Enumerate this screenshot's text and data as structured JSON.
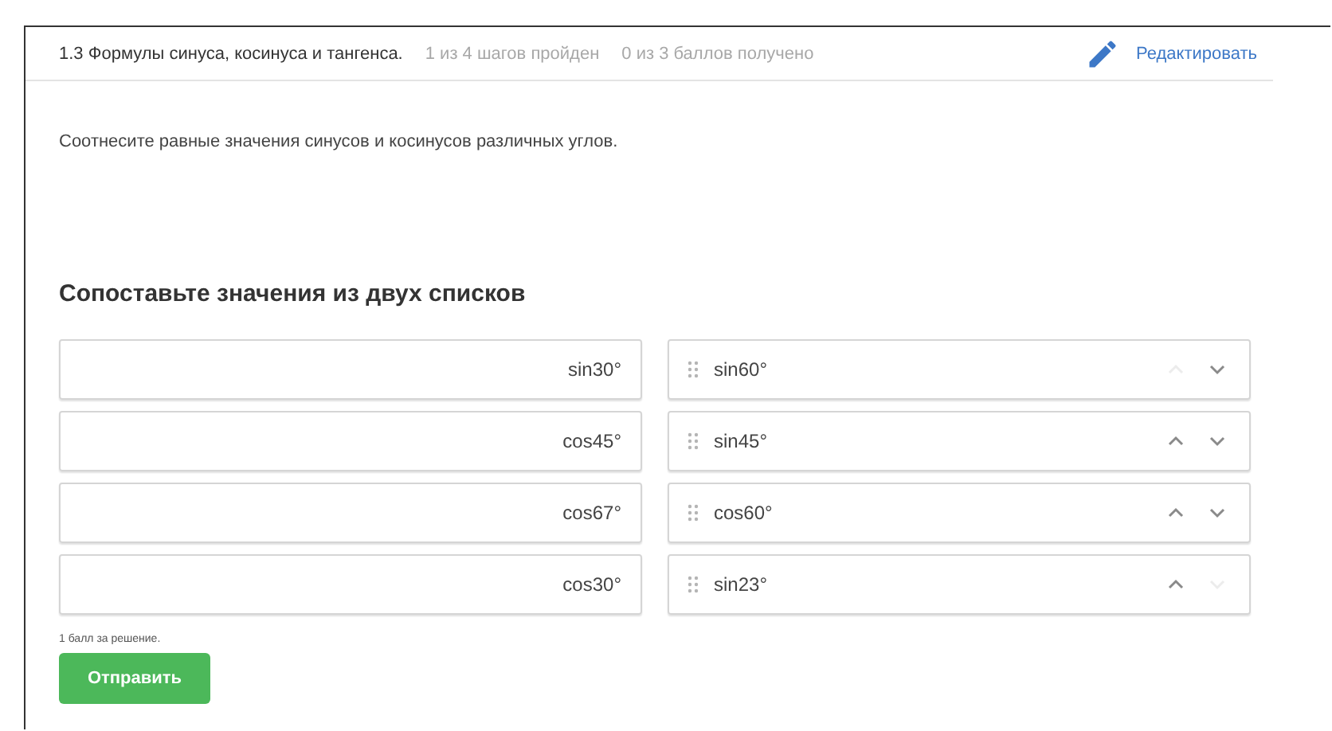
{
  "header": {
    "title": "1.3 Формулы синуса, косинуса и тангенса.",
    "steps": "1 из 4 шагов пройден",
    "points": "0 из 3 баллов  получено",
    "edit_link": "Редактировать"
  },
  "instruction": "Соотнесите равные значения синусов и косинусов различных углов.",
  "task_title": "Сопоставьте значения из двух списков",
  "pairs": [
    {
      "left": "sin30°",
      "right": "sin60°",
      "up_disabled": true,
      "down_disabled": false
    },
    {
      "left": "cos45°",
      "right": "sin45°",
      "up_disabled": false,
      "down_disabled": false
    },
    {
      "left": "cos67°",
      "right": "cos60°",
      "up_disabled": false,
      "down_disabled": false
    },
    {
      "left": "cos30°",
      "right": "sin23°",
      "up_disabled": false,
      "down_disabled": true
    }
  ],
  "score_note": "1 балл за решение.",
  "submit": "Отправить"
}
